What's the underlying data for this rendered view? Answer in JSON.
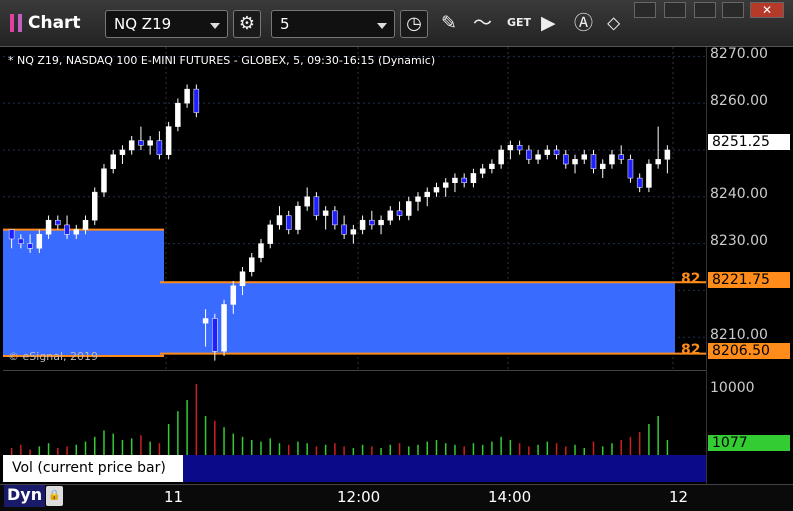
{
  "app": {
    "title": "Chart"
  },
  "toolbar": {
    "symbol": "NQ Z19",
    "interval": "5",
    "icons": [
      "settings-gear-icon",
      "clock-icon",
      "pencil-icon",
      "indicator-icon",
      "get-icon",
      "play-icon",
      "alert-icon",
      "tag-icon"
    ]
  },
  "chart": {
    "description": "* NQ Z19, NASDAQ 100 E-MINI FUTURES - GLOBEX, 5, 09:30-16:15 (Dynamic)",
    "copyright": "© eSignal, 2019",
    "price_axis": [
      "8270.00",
      "8260.00",
      "8250.00",
      "8240.00",
      "8230.00",
      "8220.00",
      "8210.00"
    ],
    "last_price": "8251.25",
    "upper_level": "8221.75",
    "lower_level": "8206.50",
    "upper_side_label": "82",
    "lower_side_label": "82",
    "volume_axis": "10000",
    "volume_value": "1077",
    "time_labels": [
      "11",
      "12:00",
      "14:00",
      "12"
    ],
    "colors": {
      "up": "#ffffff",
      "down": "#2020ff",
      "zone": "#3a6bff",
      "level": "#ff8c1a",
      "vol_up": "#33cc33",
      "vol_down": "#cc2020"
    }
  },
  "chart_data": {
    "type": "candlestick",
    "ylim": [
      8203,
      8272
    ],
    "candles": [
      [
        8233,
        8233,
        8229,
        8231
      ],
      [
        8231,
        8232,
        8229,
        8230
      ],
      [
        8230,
        8232,
        8228,
        8229
      ],
      [
        8229,
        8233,
        8228,
        8232
      ],
      [
        8232,
        8236,
        8231,
        8235
      ],
      [
        8235,
        8236,
        8233,
        8234
      ],
      [
        8234,
        8236,
        8231,
        8232
      ],
      [
        8232,
        8234,
        8231,
        8233
      ],
      [
        8233,
        8236,
        8232,
        8235
      ],
      [
        8235,
        8242,
        8234,
        8241
      ],
      [
        8241,
        8247,
        8240,
        8246
      ],
      [
        8246,
        8250,
        8245,
        8249
      ],
      [
        8249,
        8251,
        8247,
        8250
      ],
      [
        8250,
        8253,
        8249,
        8252
      ],
      [
        8252,
        8255,
        8250,
        8251
      ],
      [
        8251,
        8253,
        8249,
        8252
      ],
      [
        8252,
        8254,
        8248,
        8249
      ],
      [
        8249,
        8256,
        8248,
        8255
      ],
      [
        8255,
        8261,
        8254,
        8260
      ],
      [
        8260,
        8264,
        8259,
        8263
      ],
      [
        8263,
        8264,
        8257,
        8258
      ],
      [
        8213,
        8216,
        8208,
        8214
      ],
      [
        8214,
        8215,
        8205,
        8207
      ],
      [
        8207,
        8218,
        8206,
        8217
      ],
      [
        8217,
        8222,
        8215,
        8221
      ],
      [
        8221,
        8225,
        8219,
        8224
      ],
      [
        8224,
        8228,
        8223,
        8227
      ],
      [
        8227,
        8231,
        8226,
        8230
      ],
      [
        8230,
        8235,
        8229,
        8234
      ],
      [
        8234,
        8238,
        8233,
        8236
      ],
      [
        8236,
        8237,
        8232,
        8233
      ],
      [
        8233,
        8239,
        8232,
        8238
      ],
      [
        8238,
        8242,
        8237,
        8240
      ],
      [
        8240,
        8241,
        8235,
        8236
      ],
      [
        8236,
        8238,
        8233,
        8237
      ],
      [
        8237,
        8238,
        8233,
        8234
      ],
      [
        8234,
        8236,
        8231,
        8232
      ],
      [
        8232,
        8234,
        8230,
        8233
      ],
      [
        8233,
        8236,
        8232,
        8235
      ],
      [
        8235,
        8237,
        8233,
        8234
      ],
      [
        8234,
        8236,
        8232,
        8235
      ],
      [
        8235,
        8238,
        8234,
        8237
      ],
      [
        8237,
        8239,
        8235,
        8236
      ],
      [
        8236,
        8240,
        8235,
        8239
      ],
      [
        8239,
        8241,
        8237,
        8240
      ],
      [
        8240,
        8242,
        8238,
        8241
      ],
      [
        8241,
        8243,
        8240,
        8242
      ],
      [
        8242,
        8244,
        8240,
        8243
      ],
      [
        8243,
        8245,
        8241,
        8244
      ],
      [
        8244,
        8245,
        8242,
        8243
      ],
      [
        8243,
        8246,
        8242,
        8245
      ],
      [
        8245,
        8247,
        8244,
        8246
      ],
      [
        8246,
        8248,
        8245,
        8247
      ],
      [
        8247,
        8251,
        8246,
        8250
      ],
      [
        8250,
        8252,
        8248,
        8251
      ],
      [
        8251,
        8252,
        8249,
        8250
      ],
      [
        8250,
        8251,
        8247,
        8248
      ],
      [
        8248,
        8250,
        8247,
        8249
      ],
      [
        8249,
        8251,
        8248,
        8250
      ],
      [
        8250,
        8251,
        8248,
        8249
      ],
      [
        8249,
        8250,
        8246,
        8247
      ],
      [
        8247,
        8249,
        8245,
        8248
      ],
      [
        8248,
        8250,
        8247,
        8249
      ],
      [
        8249,
        8250,
        8245,
        8246
      ],
      [
        8246,
        8248,
        8244,
        8247
      ],
      [
        8247,
        8250,
        8246,
        8249
      ],
      [
        8249,
        8251,
        8247,
        8248
      ],
      [
        8248,
        8249,
        8243,
        8244
      ],
      [
        8244,
        8245,
        8241,
        8242
      ],
      [
        8242,
        8248,
        8241,
        8247
      ],
      [
        8247,
        8255,
        8246,
        8248
      ],
      [
        8248,
        8251,
        8245,
        8250
      ]
    ],
    "volumes": [
      5,
      7,
      4,
      6,
      8,
      5,
      6,
      7,
      9,
      12,
      16,
      14,
      10,
      11,
      13,
      9,
      8,
      20,
      28,
      35,
      45,
      25,
      22,
      18,
      14,
      12,
      10,
      9,
      11,
      8,
      7,
      9,
      8,
      6,
      7,
      8,
      6,
      5,
      7,
      6,
      5,
      7,
      8,
      6,
      7,
      9,
      10,
      8,
      7,
      6,
      8,
      7,
      9,
      12,
      10,
      8,
      6,
      7,
      9,
      8,
      6,
      7,
      5,
      9,
      6,
      8,
      10,
      12,
      15,
      20,
      25,
      10
    ]
  }
}
